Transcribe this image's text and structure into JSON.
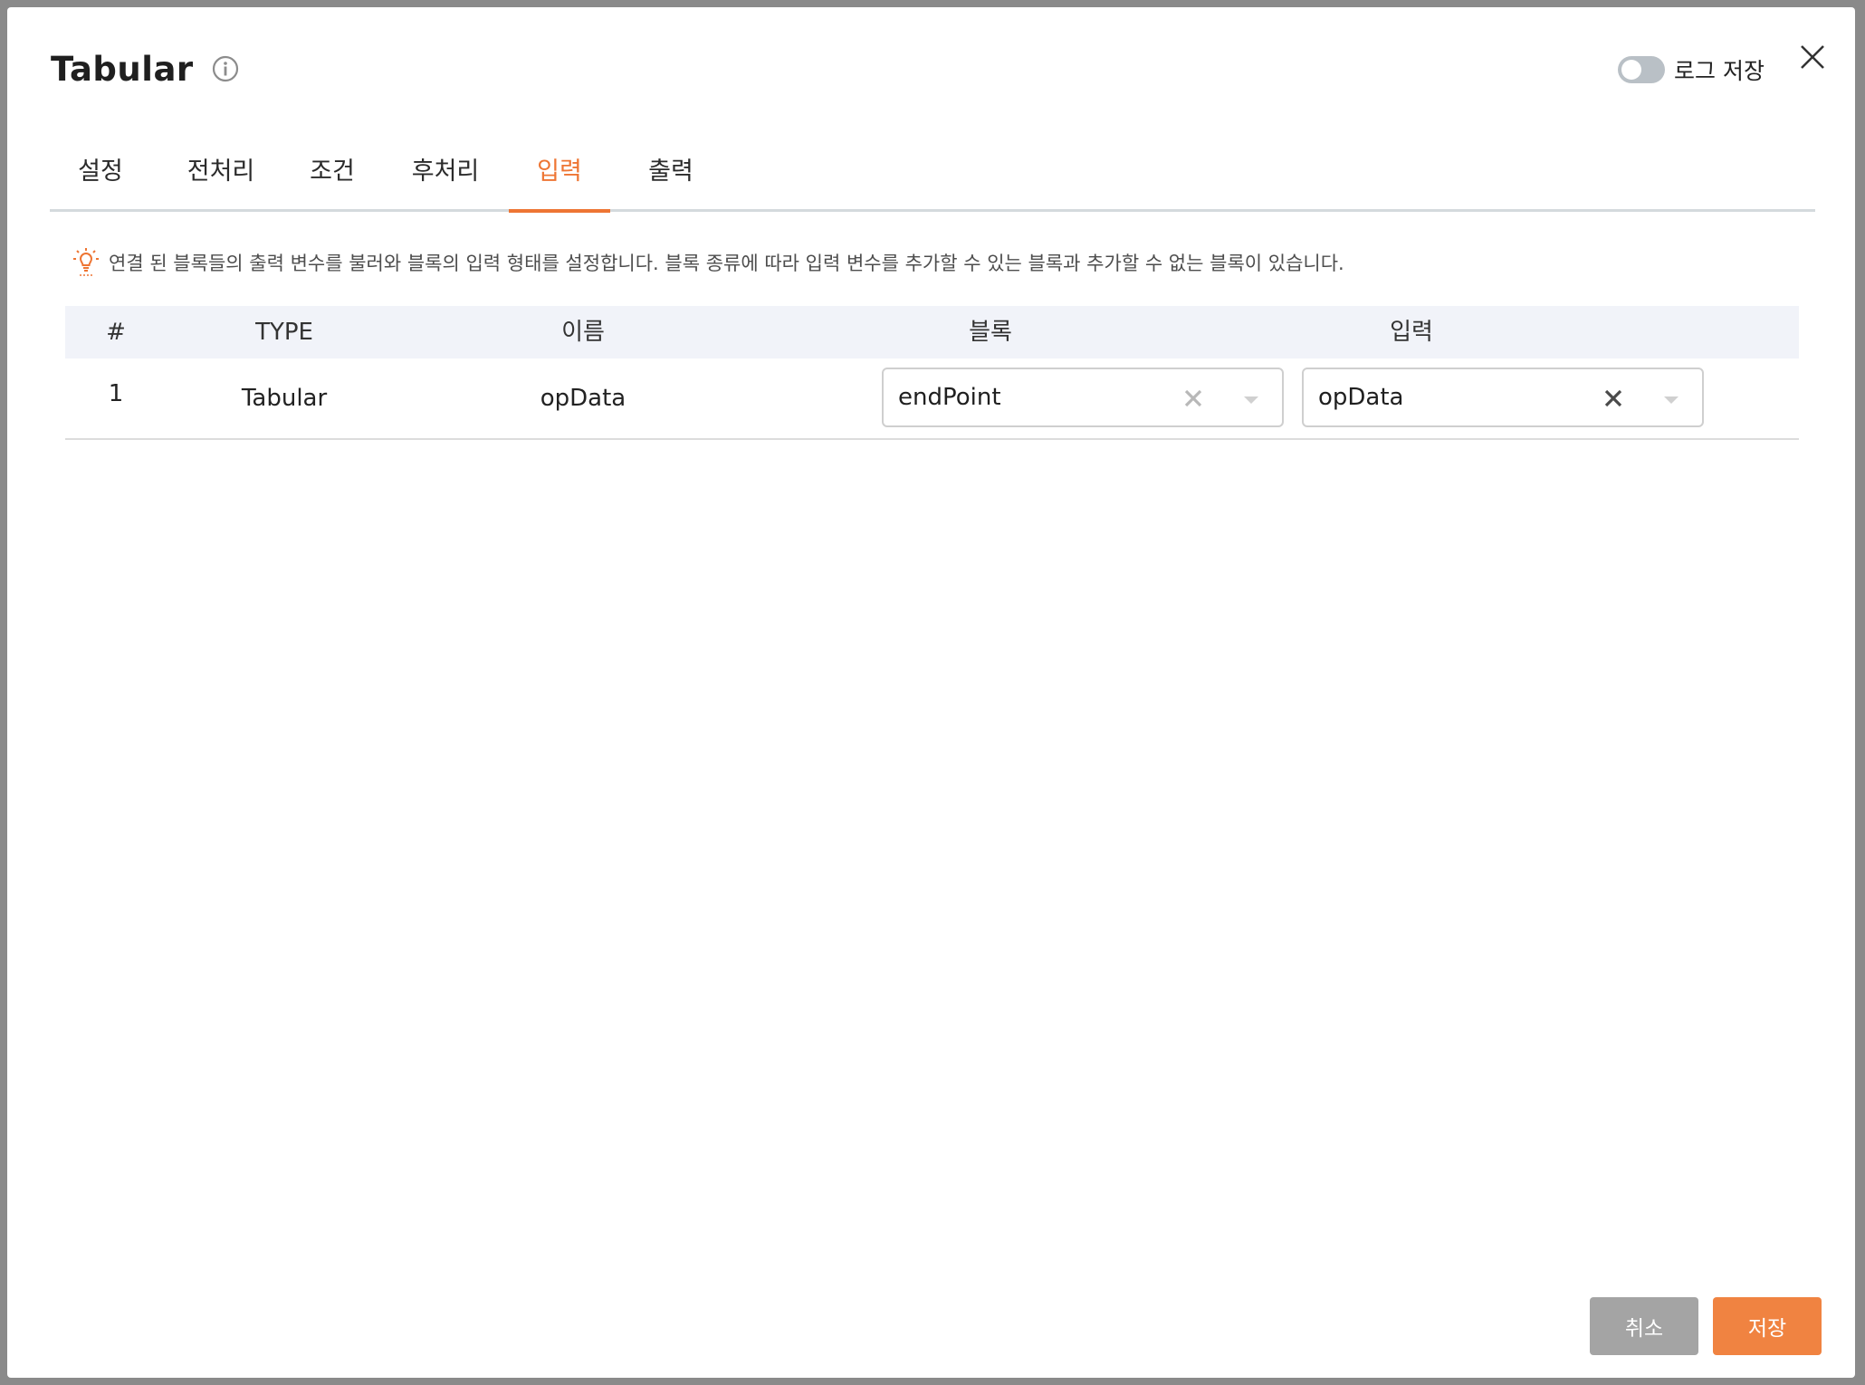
{
  "modal": {
    "title": "Tabular",
    "log_toggle_label": "로그 저장",
    "log_toggle_on": false
  },
  "tabs": [
    {
      "label": "설정",
      "active": false
    },
    {
      "label": "전처리",
      "active": false
    },
    {
      "label": "조건",
      "active": false
    },
    {
      "label": "후처리",
      "active": false
    },
    {
      "label": "입력",
      "active": true
    },
    {
      "label": "출력",
      "active": false
    }
  ],
  "notice": "연결 된 블록들의 출력 변수를 불러와 블록의 입력 형태를 설정합니다. 블록 종류에 따라 입력 변수를 추가할 수 있는 블록과 추가할 수 없는 블록이 있습니다.",
  "table": {
    "headers": {
      "index": "#",
      "type": "TYPE",
      "name": "이름",
      "block": "블록",
      "input": "입력"
    },
    "rows": [
      {
        "index": "1",
        "type": "Tabular",
        "name": "opData",
        "block": "endPoint",
        "input": "opData"
      }
    ]
  },
  "footer": {
    "cancel_label": "취소",
    "save_label": "저장"
  },
  "colors": {
    "accent": "#ee7533",
    "header_bg": "#f1f3f9",
    "cancel_bg": "#a4a4a4",
    "save_bg": "#f08341"
  },
  "icons": {
    "info": "info-icon",
    "close": "close-icon",
    "notice": "lightbulb-icon",
    "clear": "clear-icon",
    "dropdown": "chevron-down-icon"
  }
}
